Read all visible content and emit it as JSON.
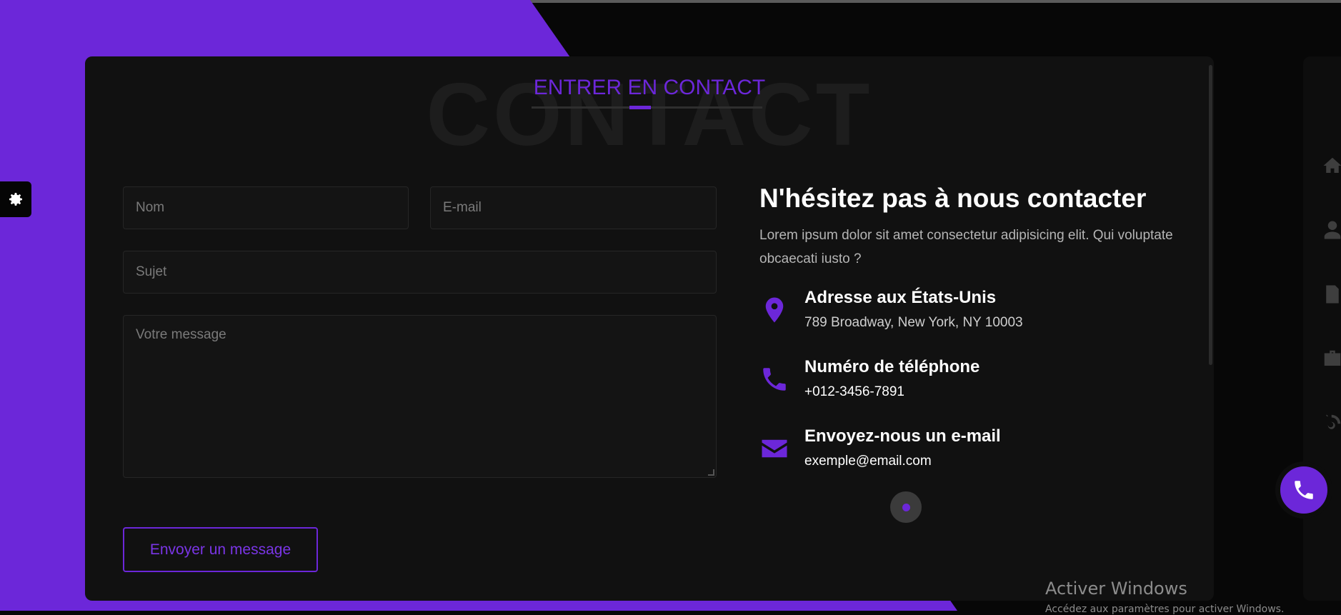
{
  "section": {
    "background_word": "CONTACT",
    "title": "ENTRER EN CONTACT"
  },
  "form": {
    "name_placeholder": "Nom",
    "email_placeholder": "E-mail",
    "subject_placeholder": "Sujet",
    "message_placeholder": "Votre message",
    "submit_label": "Envoyer un message"
  },
  "info": {
    "heading": "N'hésitez pas à nous contacter",
    "text": "Lorem ipsum dolor sit amet consectetur adipisicing elit. Qui voluptate obcaecati iusto ?",
    "items": [
      {
        "icon": "map-marker-icon",
        "title": "Adresse aux États-Unis",
        "value": "789 Broadway, New York, NY 10003"
      },
      {
        "icon": "phone-icon",
        "title": "Numéro de téléphone",
        "value": "+012-3456-7891"
      },
      {
        "icon": "envelope-icon",
        "title": "Envoyez-nous un e-mail",
        "value": "exemple@email.com"
      }
    ]
  },
  "sidenav": {
    "items": [
      "home-icon",
      "user-icon",
      "document-icon",
      "briefcase-icon",
      "blog-icon"
    ]
  },
  "windows_watermark": {
    "title": "Activer Windows",
    "subtitle": "Accédez aux paramètres pour activer Windows."
  },
  "colors": {
    "accent": "#6c27d9",
    "card": "#111111",
    "page": "#070707"
  }
}
